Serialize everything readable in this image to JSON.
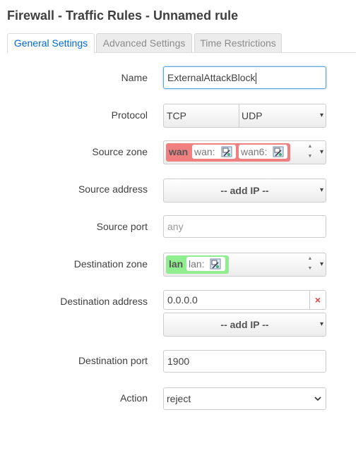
{
  "page": {
    "title": "Firewall - Traffic Rules - Unnamed rule"
  },
  "tabs": [
    {
      "label": "General Settings",
      "active": true
    },
    {
      "label": "Advanced Settings",
      "active": false
    },
    {
      "label": "Time Restrictions",
      "active": false
    }
  ],
  "form": {
    "name": {
      "label": "Name",
      "value": "ExternalAttackBlock"
    },
    "protocol": {
      "label": "Protocol",
      "values": [
        "TCP",
        "UDP"
      ]
    },
    "source_zone": {
      "label": "Source zone",
      "zone": "wan",
      "networks": [
        "wan:",
        "wan6:"
      ],
      "color": "#f08080"
    },
    "source_address": {
      "label": "Source address",
      "button": "-- add IP --"
    },
    "source_port": {
      "label": "Source port",
      "placeholder": "any"
    },
    "destination_zone": {
      "label": "Destination zone",
      "zone": "lan",
      "networks": [
        "lan:"
      ],
      "color": "#90ee90"
    },
    "destination_address": {
      "label": "Destination address",
      "value": "0.0.0.0",
      "clear": "×",
      "button": "-- add IP --"
    },
    "destination_port": {
      "label": "Destination port",
      "value": "1900"
    },
    "action": {
      "label": "Action",
      "value": "reject"
    }
  },
  "icons": {
    "caret": "▾",
    "spinner_up": "▲",
    "spinner_down": "▼",
    "select_chevron": "⌄"
  }
}
